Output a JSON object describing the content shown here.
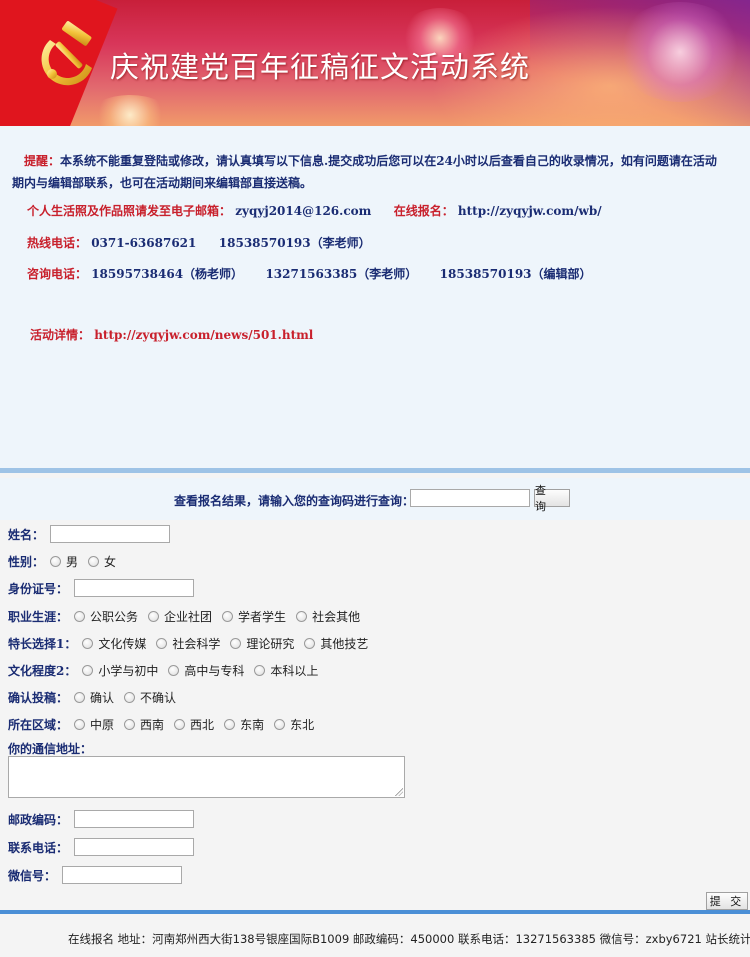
{
  "banner": {
    "title": "庆祝建党百年征稿征文活动系统"
  },
  "notice": {
    "tip_label": "提醒：",
    "tip_text": "本系统不能重复登陆或修改，请认真填写以下信息.提交成功后您可以在24小时以后查看自己的收录情况，如有问题请在活动期内与编辑部联系，也可在活动期间来编辑部直接送稿。",
    "email_label": "个人生活照及作品照请发至电子邮箱：",
    "email_value": "zyqyj2014@126.com",
    "online_label": "在线报名：",
    "online_url": "http://zyqyjw.com/wb/",
    "hotline_label": "热线电话：",
    "hotline_1": "0371-63687621",
    "hotline_2": "18538570193（李老师）",
    "consult_label": "咨询电话：",
    "consult_1": "18595738464（杨老师）",
    "consult_2": "13271563385（李老师）",
    "consult_3": "18538570193（编辑部）",
    "detail_label": "活动详情：",
    "detail_url": "http://zyqyjw.com/news/501.html"
  },
  "search": {
    "label": "查看报名结果，请输入您的查询码进行查询：",
    "button": "查 询",
    "value": ""
  },
  "form": {
    "name_label": "姓名：",
    "gender_label": "性别：",
    "gender_options": [
      "男",
      "女"
    ],
    "id_label": "身份证号：",
    "career_label": "职业生涯：",
    "career_options": [
      "公职公务",
      "企业社团",
      "学者学生",
      "社会其他"
    ],
    "specialty_label": "特长选择1：",
    "specialty_options": [
      "文化传媒",
      "社会科学",
      "理论研究",
      "其他技艺"
    ],
    "education_label": "文化程度2：",
    "education_options": [
      "小学与初中",
      "高中与专科",
      "本科以上"
    ],
    "confirm_label": "确认投稿：",
    "confirm_options": [
      "确认",
      "不确认"
    ],
    "region_label": "所在区域：",
    "region_options": [
      "中原",
      "西南",
      "西北",
      "东南",
      "东北"
    ],
    "address_label": "你的通信地址：",
    "postcode_label": "邮政编码：",
    "phone_label": "联系电话：",
    "wechat_label": "微信号：",
    "submit": "提 交"
  },
  "footer": {
    "text": "在线报名 地址：河南郑州西大街138号银座国际B1009 邮政编码：450000 联系电话：13271563385 微信号：zxby6721 站长统计"
  },
  "colors": {
    "accent_red": "#c8202c",
    "text_navy": "#1a2c73",
    "footer_border": "#4b8fd6"
  }
}
